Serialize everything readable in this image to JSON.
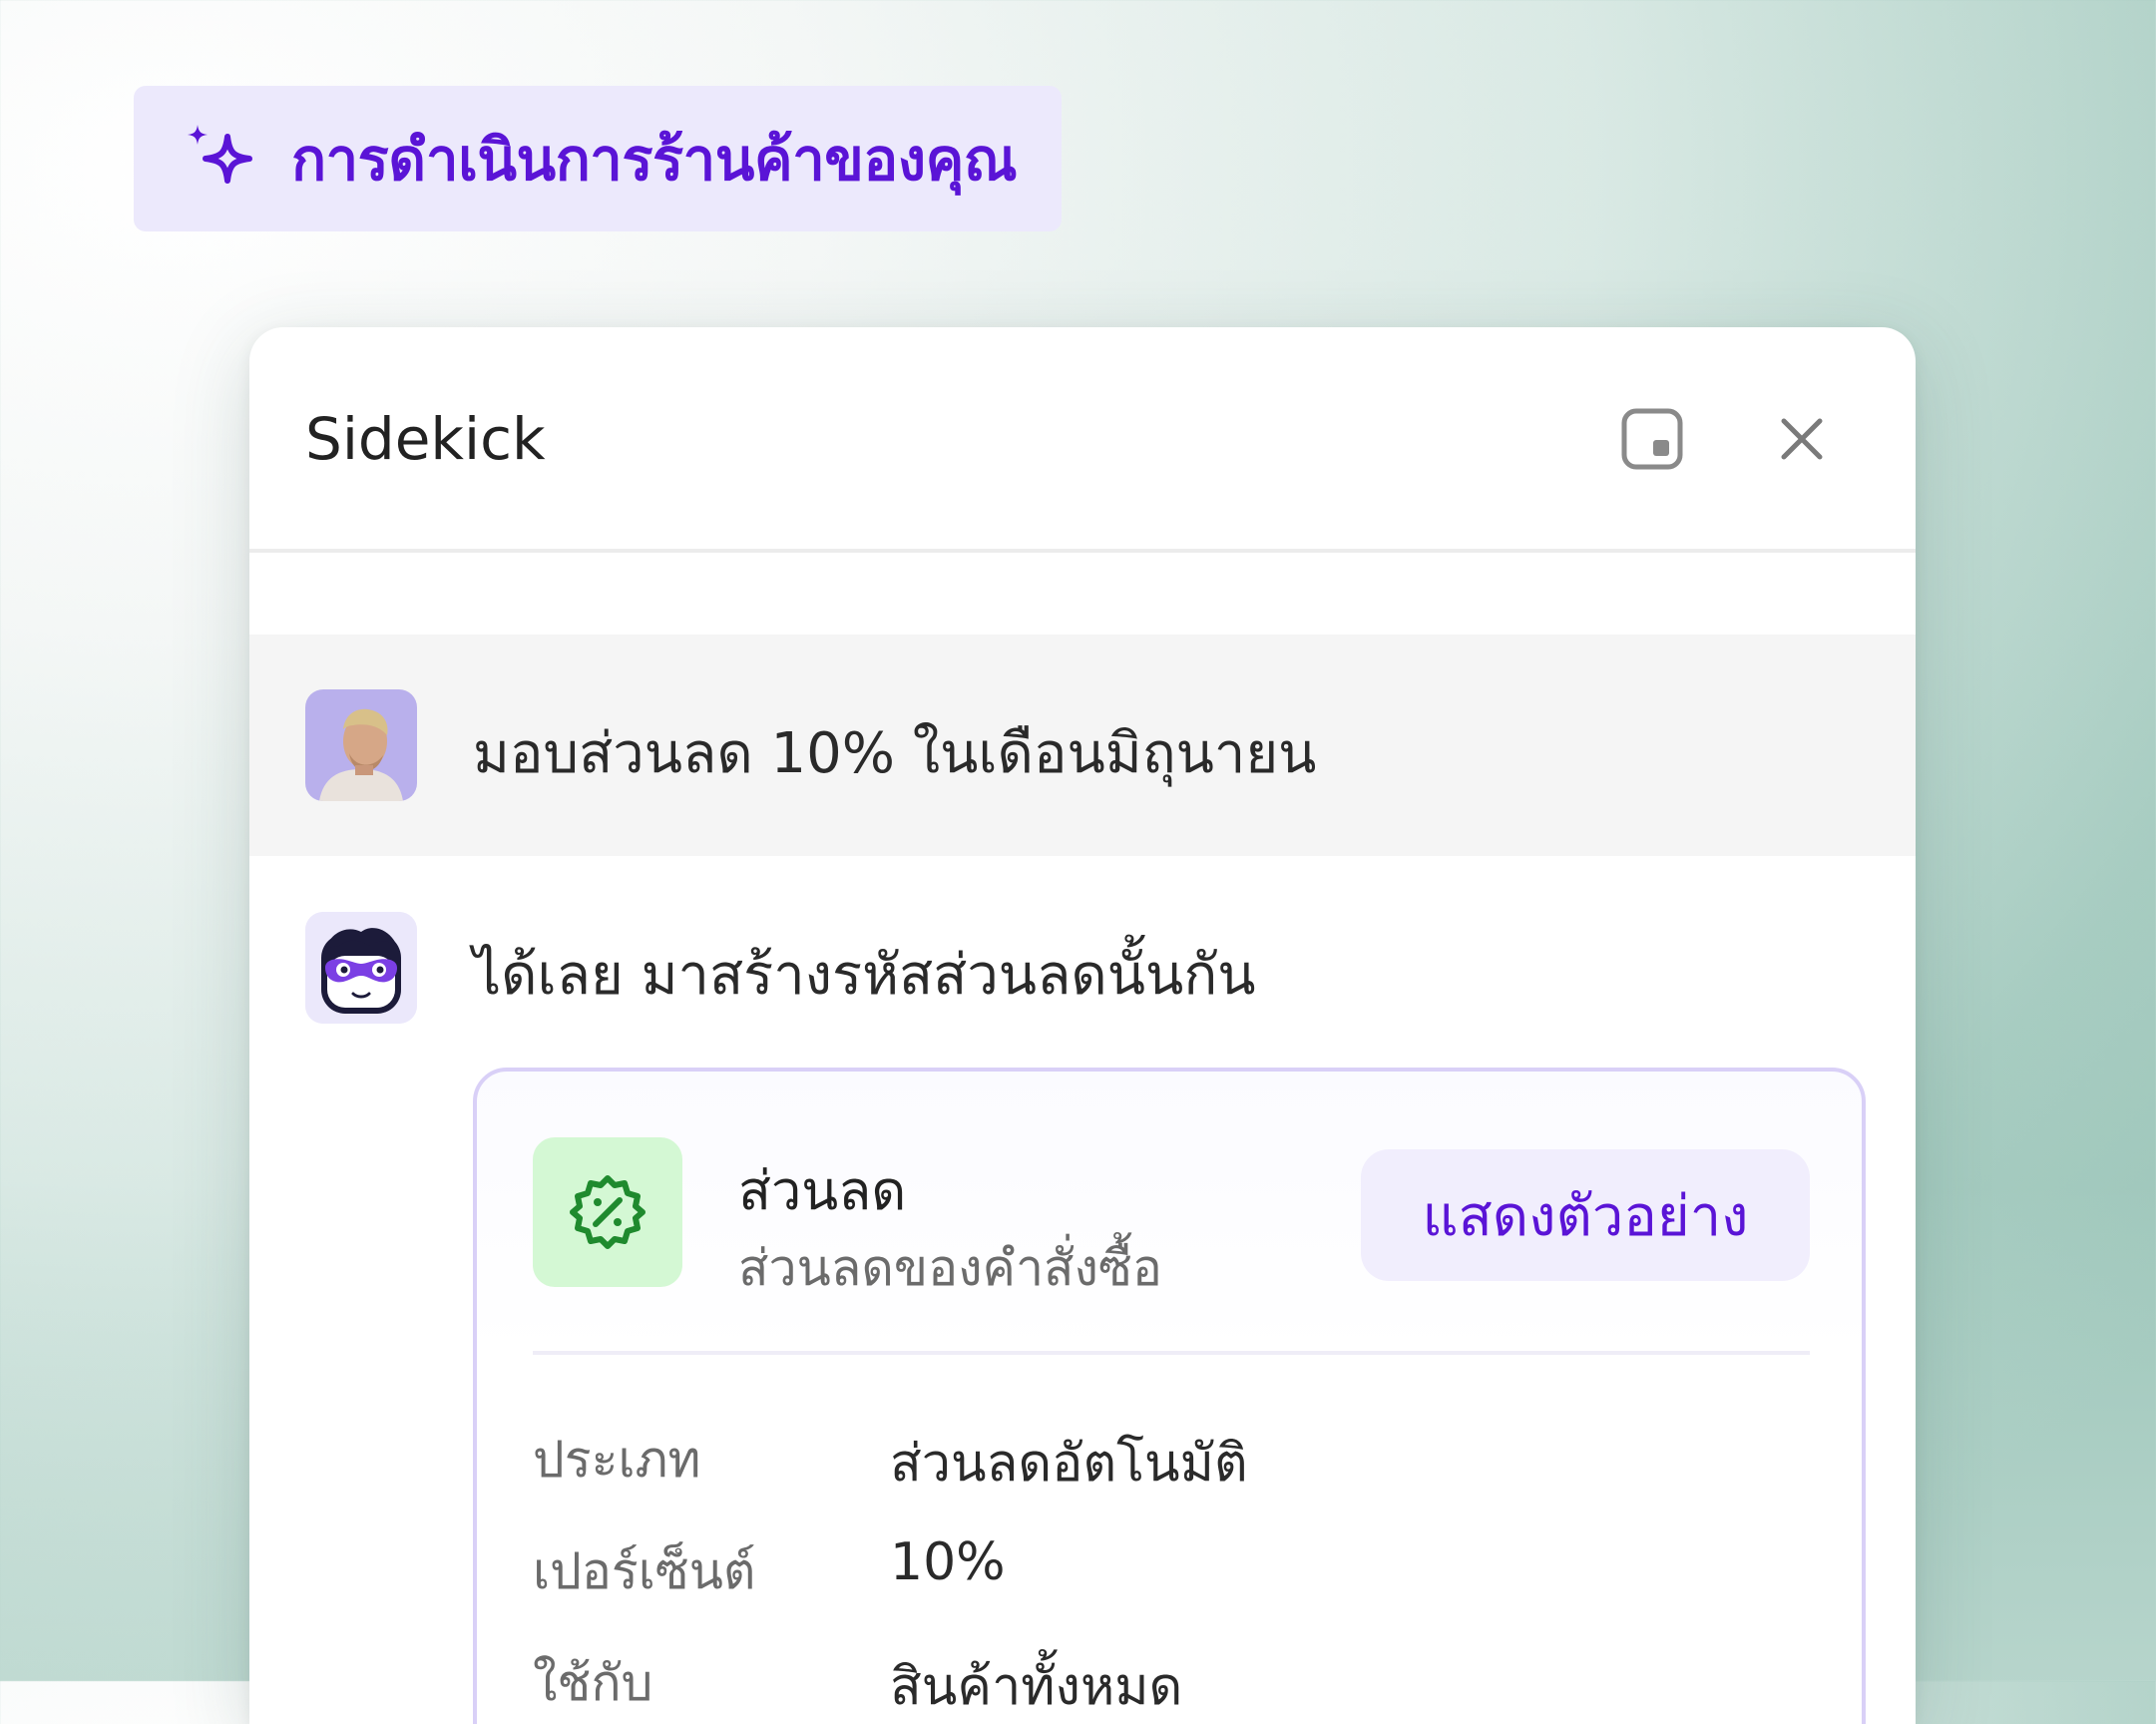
{
  "badge": {
    "label": "การดำเนินการร้านค้าของคุณ",
    "icon": "sparkle-icon"
  },
  "panel": {
    "title": "Sidekick",
    "dock_icon": "dock-icon",
    "close_icon": "close-icon"
  },
  "conversation": {
    "user_message": "มอบส่วนลด 10% ในเดือนมิถุนายน",
    "assistant_message": "ได้เลย มาสร้างรหัสส่วนลดนั้นกัน"
  },
  "card": {
    "icon": "discount-badge-icon",
    "title": "ส่วนลด",
    "subtitle": "ส่วนลดของคำสั่งซื้อ",
    "preview_button": "แสดงตัวอย่าง",
    "details": [
      {
        "label": "ประเภท",
        "value": "ส่วนลดอัตโนมัติ"
      },
      {
        "label": "เปอร์เซ็นต์",
        "value": "10%"
      },
      {
        "label": "ใช้กับ",
        "value": "สินค้าทั้งหมด"
      }
    ]
  },
  "colors": {
    "accent": "#5a14d6",
    "badge_bg": "#ece9fc",
    "discount_icon_bg": "#d4f8d4",
    "discount_icon": "#1f8a2e"
  }
}
